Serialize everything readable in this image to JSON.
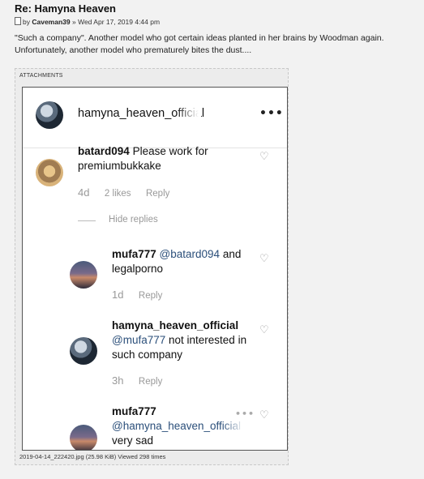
{
  "post": {
    "title": "Re: Hamyna Heaven",
    "by_prefix": "by",
    "author": "Caveman39",
    "date": "» Wed Apr 17, 2019 4:44 pm",
    "body": "\"Such a company\". Another model who got certain ideas planted in her brains by Woodman again. Unfortunately, another model who prematurely bites the dust...."
  },
  "attachment": {
    "label": "ATTACHMENTS",
    "caption": "2019-04-14_222420.jpg (25.98 KiB) Viewed 298 times"
  },
  "instagram": {
    "header_user": "hamyna_heaven_official",
    "comments": [
      {
        "user": "batard094",
        "text": "Please work for premiumbukkake",
        "age": "4d",
        "likes": "2 likes",
        "reply": "Reply"
      },
      {
        "user": "mufa777",
        "mention": "@batard094",
        "text": "and legalporno",
        "age": "1d",
        "reply": "Reply"
      },
      {
        "user": "hamyna_heaven_official",
        "mention": "@mufa777",
        "text": "not interested in such company",
        "age": "3h",
        "reply": "Reply"
      },
      {
        "user": "mufa777",
        "mention": "@hamyna_heaven_official",
        "text": "very sad"
      }
    ],
    "hide_replies": "Hide replies"
  },
  "icons": {
    "more": "more-options-icon",
    "heart": "heart-icon",
    "doc": "post-doc-icon"
  },
  "colors": {
    "mention": "#2b4f7a",
    "meta": "#999999"
  }
}
